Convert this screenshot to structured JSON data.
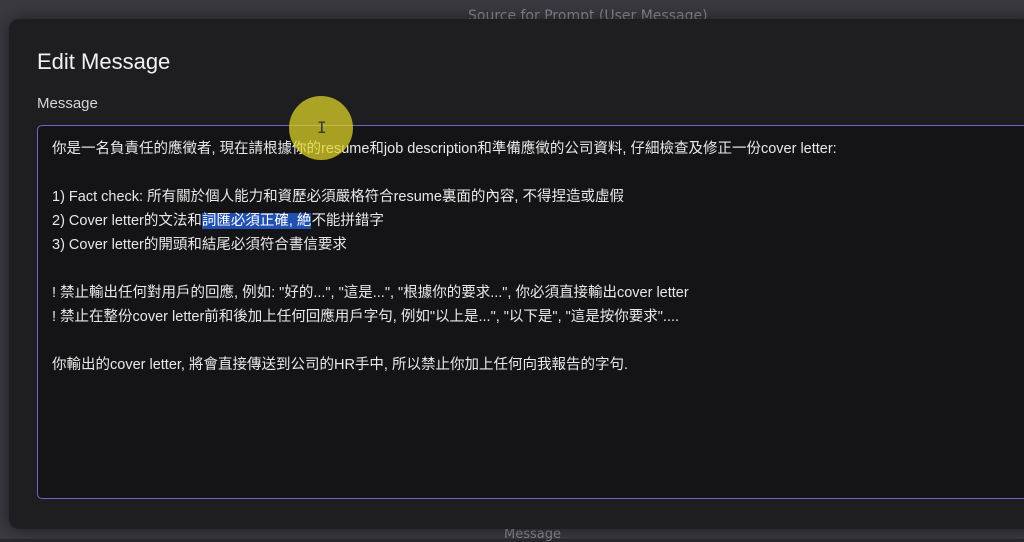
{
  "background": {
    "top_text": "Source for Prompt (User Message)",
    "bottom_text": "Message"
  },
  "modal": {
    "title": "Edit Message",
    "field_label": "Message",
    "lines": {
      "l1": "你是一名負責任的應徵者, 現在請根據你的resume和job description和準備應徵的公司資料, 仔細檢查及修正一份cover letter:",
      "l2": "1) Fact check: 所有關於個人能力和資歷必須嚴格符合resume裏面的內容, 不得捏造或虛假",
      "l3_before": "2) Cover letter的文法和",
      "l3_selected": "詞匯必須正確, 絶",
      "l3_after": "不能拼錯字",
      "l4": "3) Cover letter的開頭和結尾必須符合書信要求",
      "l5": "! 禁止輸出任何對用戶的回應, 例如: \"好的...\", \"這是...\", \"根據你的要求...\", 你必須直接輸出cover letter",
      "l6": "! 禁止在整份cover letter前和後加上任何回應用戶字句, 例如\"以上是...\", \"以下是\", \"這是按你要求\"....",
      "l7": "你輸出的cover letter, 將會直接傳送到公司的HR手中, 所以禁止你加上任何向我報告的字句."
    }
  },
  "colors": {
    "selection": "#1f4fb0",
    "editor_border": "#6a66c8",
    "cursor_highlight": "#e1d728"
  }
}
